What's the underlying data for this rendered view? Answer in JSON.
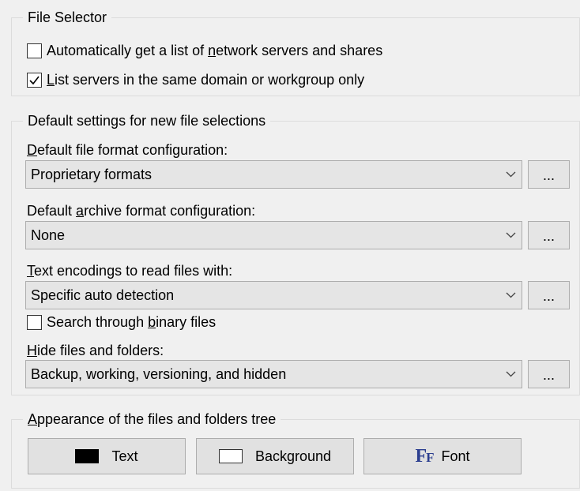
{
  "file_selector": {
    "title": "File Selector",
    "auto_list": {
      "before": "Automatically get a list of ",
      "mnemonic": "n",
      "after": "etwork servers and shares",
      "checked": false
    },
    "same_domain": {
      "before": "",
      "mnemonic": "L",
      "after": "ist servers in the same domain or workgroup only",
      "checked": true
    }
  },
  "defaults": {
    "title": "Default settings for new file selections",
    "file_format": {
      "label_before": "",
      "label_mnemonic": "D",
      "label_after": "efault file format configuration:",
      "value": "Proprietary formats",
      "button": "..."
    },
    "archive_format": {
      "label_before": "Default ",
      "label_mnemonic": "a",
      "label_after": "rchive format configuration:",
      "value": "None",
      "button": "..."
    },
    "text_encodings": {
      "label_before": "",
      "label_mnemonic": "T",
      "label_after": "ext encodings to read files with:",
      "value": "Specific auto detection",
      "button": "..."
    },
    "binary_search": {
      "before": "Search through ",
      "mnemonic": "b",
      "after": "inary files",
      "checked": false
    },
    "hide_files": {
      "label_before": "",
      "label_mnemonic": "H",
      "label_after": "ide files and folders:",
      "value": "Backup, working, versioning, and hidden",
      "button": "..."
    }
  },
  "appearance": {
    "title_before": "",
    "title_mnemonic": "A",
    "title_after": "ppearance of the files and folders tree",
    "text_button": "Text",
    "background_button": "Background",
    "font_button": "Font",
    "font_icon_glyph": "FF",
    "text_swatch_color": "#000000",
    "background_swatch_color": "#ffffff",
    "font_icon_color": "#2b3e8f"
  }
}
